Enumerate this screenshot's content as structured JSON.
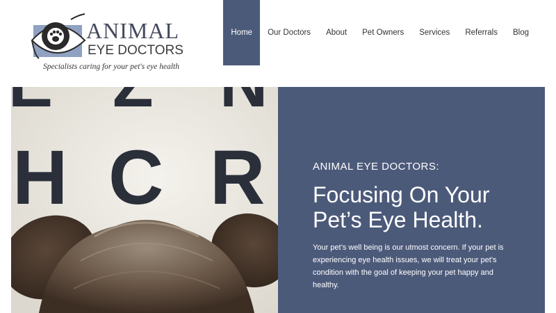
{
  "brand": {
    "title_line1": "ANIMAL",
    "title_line2": "EYE DOCTORS",
    "tagline": "Specialists caring for your pet's eye health",
    "logo_icon": "eye-paw-icon"
  },
  "nav": {
    "items": [
      {
        "label": "Home",
        "active": true
      },
      {
        "label": "Our Doctors"
      },
      {
        "label": "About"
      },
      {
        "label": "Pet Owners"
      },
      {
        "label": "Services"
      },
      {
        "label": "Referrals"
      },
      {
        "label": "Blog"
      }
    ]
  },
  "hero": {
    "eyebrow": "ANIMAL EYE DOCTORS:",
    "heading": "Focusing On Your Pet’s Eye Health.",
    "body": "Your pet’s well being is our utmost concern. If your pet is experiencing eye health issues, we will treat your pet’s condition with the goal of keeping your pet happy and healthy.",
    "chart_letters": [
      "E",
      "Z",
      "N",
      "H",
      "C",
      "R"
    ]
  },
  "colors": {
    "accent": "#4c5a7a",
    "logo_blue": "#8fa2c2"
  }
}
